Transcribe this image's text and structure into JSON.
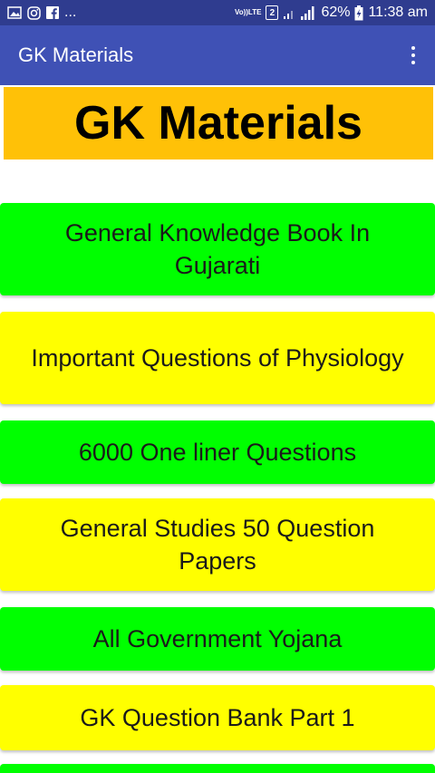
{
  "status_bar": {
    "notif_dots": "...",
    "network_label": "LTE",
    "volte_label": "Vo))",
    "sim_slot": "2",
    "battery": "62%",
    "time": "11:38 am"
  },
  "app_bar": {
    "title": "GK Materials"
  },
  "banner": {
    "title": "GK Materials",
    "color": "#ffc107"
  },
  "menu": {
    "items": [
      {
        "label": "General Knowledge Book In Gujarati",
        "color": "#00ff00"
      },
      {
        "label": "Important Questions of Physiology",
        "color": "#ffff00"
      },
      {
        "label": "6000 One liner Questions",
        "color": "#00ff00"
      },
      {
        "label": "General Studies 50 Question Papers",
        "color": "#ffff00"
      },
      {
        "label": "All Government Yojana",
        "color": "#00ff00"
      },
      {
        "label": "GK Question Bank Part 1",
        "color": "#ffff00"
      },
      {
        "label": "",
        "color": "#00ff00"
      }
    ]
  }
}
